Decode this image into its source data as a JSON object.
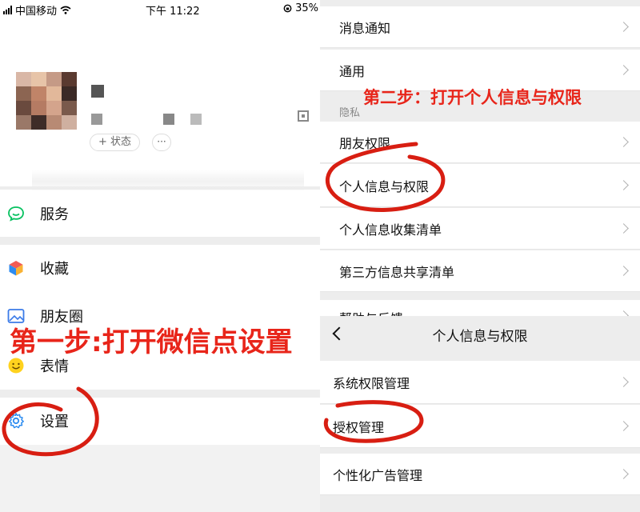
{
  "status_bar": {
    "carrier": "中国移动",
    "time": "下午 11:22",
    "battery": "35%"
  },
  "profile": {
    "status_button": "+ 状态",
    "more_button": "···"
  },
  "left_menu": {
    "services": "服务",
    "favorites": "收藏",
    "moments": "朋友圈",
    "stickers": "表情",
    "settings": "设置"
  },
  "annotations": {
    "step1": "第一步:打开微信点设置",
    "step2": "第二步：打开个人信息与权限"
  },
  "privacy_settings": {
    "notifications": "消息通知",
    "general": "通用",
    "section_privacy": "隐私",
    "friend_permissions": "朋友权限",
    "personal_info_permissions": "个人信息与权限",
    "personal_info_collection": "个人信息收集清单",
    "third_party_sharing": "第三方信息共享清单",
    "help_feedback": "帮助与反馈"
  },
  "personal_info_page": {
    "title": "个人信息与权限",
    "system_permissions": "系统权限管理",
    "authorization": "授权管理",
    "personalized_ads": "个性化广告管理"
  },
  "colors": {
    "annotation_red": "#e8251a",
    "wechat_green": "#07c160",
    "background_gray": "#ededed"
  },
  "icons": [
    "signal-icon",
    "wifi-icon",
    "battery-icon",
    "qr-code-icon",
    "services-icon",
    "favorites-icon",
    "moments-icon",
    "stickers-icon",
    "settings-icon",
    "chevron-right-icon",
    "back-icon"
  ]
}
